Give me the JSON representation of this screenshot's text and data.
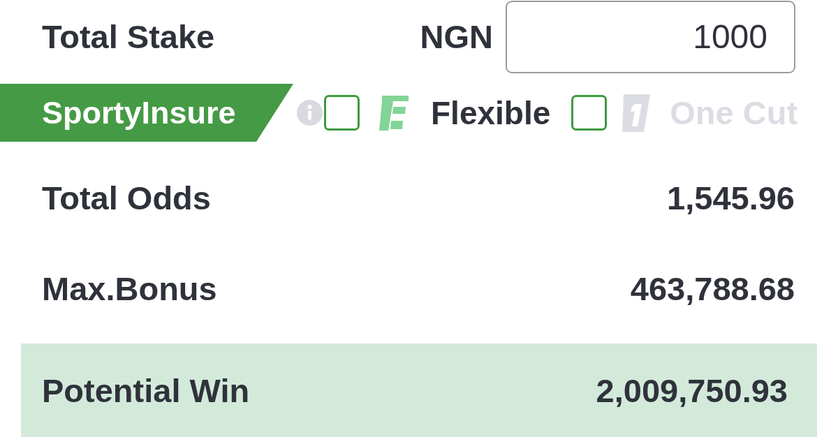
{
  "stake": {
    "label": "Total Stake",
    "currency": "NGN",
    "value": "1000"
  },
  "insure": {
    "label": "SportyInsure",
    "checked": false
  },
  "flexible": {
    "label": "Flexible",
    "checked": false
  },
  "one_cut": {
    "label": "One Cut",
    "disabled": true
  },
  "summary": [
    {
      "label": "Total Odds",
      "value": "1,545.96",
      "highlighted": false
    },
    {
      "label": "Max.Bonus",
      "value": "463,788.68",
      "highlighted": false
    },
    {
      "label": "Potential Win",
      "value": "2,009,750.93",
      "highlighted": true
    }
  ]
}
